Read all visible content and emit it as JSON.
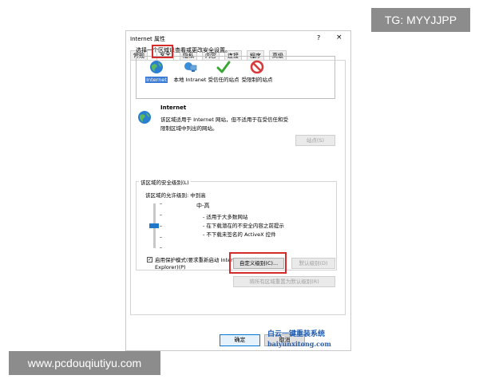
{
  "watermark": {
    "top": "TG: MYYJJPP",
    "bottom": "www.pcdouqiutiyu.com",
    "logo_line1": "白云一键重装系统",
    "logo_line2": "baiyunxitong.com"
  },
  "window": {
    "title": "Internet 属性",
    "help": "?",
    "close": "×"
  },
  "tabs": [
    {
      "label": "常规"
    },
    {
      "label": "安全",
      "active": true
    },
    {
      "label": "隐私"
    },
    {
      "label": "内容"
    },
    {
      "label": "连接"
    },
    {
      "label": "程序"
    },
    {
      "label": "高级"
    }
  ],
  "zones": {
    "prompt": "选择一个区域以查看或更改安全设置。",
    "items": [
      {
        "label": "Internet",
        "icon": "globe-icon",
        "selected": true
      },
      {
        "label": "本地 Intranet",
        "icon": "intranet-icon"
      },
      {
        "label": "受信任的站点",
        "icon": "check-icon"
      },
      {
        "label": "受限制的站点",
        "icon": "restricted-icon"
      }
    ]
  },
  "zone_detail": {
    "name": "Internet",
    "description": "该区域适用于 Internet 网站，但不适用于在受信任和受限制区域中列出的网站。",
    "sites_button": "站点(S)"
  },
  "security_level": {
    "group_title": "该区域的安全级别(L)",
    "allowed": "该区域的允许级别: 中到高",
    "level": "中-高",
    "bullets": [
      "- 适用于大多数网站",
      "- 在下载潜在的不安全内容之前提示",
      "- 不下载未签名的 ActiveX 控件"
    ],
    "slider_value": "中-高"
  },
  "protected_mode": {
    "label": "启用保护模式(要求重新启动 Internet Explorer)(P)",
    "checked": true
  },
  "buttons": {
    "custom_level": "自定义级别(C)...",
    "default_level": "默认级别(D)",
    "reset_all": "将所有区域重置为默认级别(R)",
    "ok": "确定",
    "cancel": "取消"
  },
  "colors": {
    "highlight": "#d62b2b",
    "selection": "#3a7bd5",
    "slider": "#1f78c8"
  }
}
